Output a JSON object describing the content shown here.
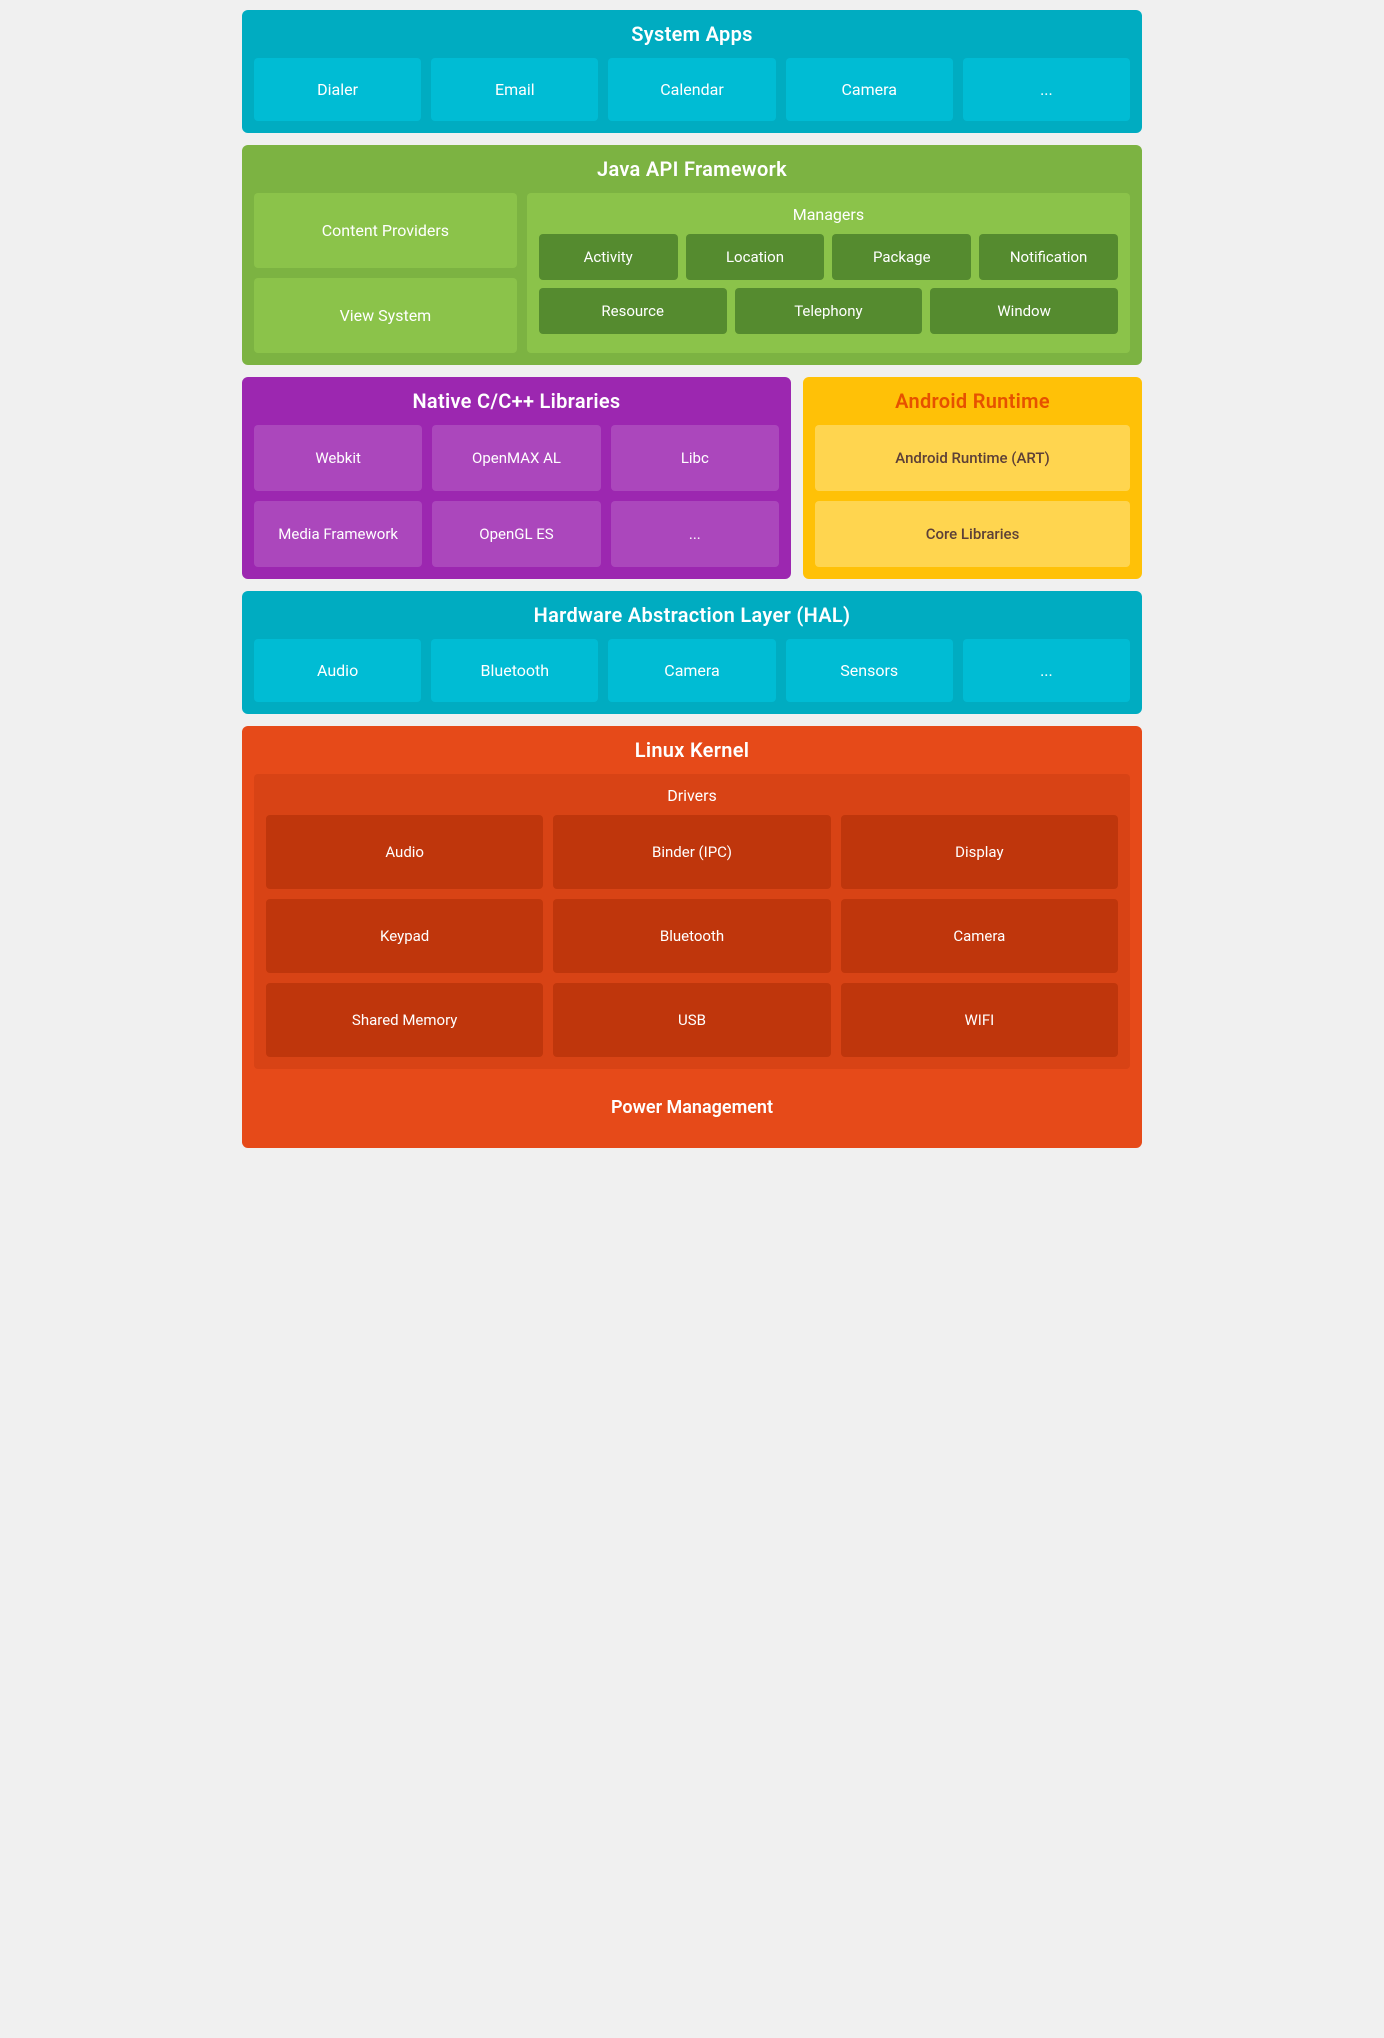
{
  "systemApps": {
    "title": "System Apps",
    "items": [
      "Dialer",
      "Email",
      "Calendar",
      "Camera",
      "..."
    ]
  },
  "javaApi": {
    "title": "Java API Framework",
    "contentProviders": "Content Providers",
    "viewSystem": "View System",
    "managers": {
      "title": "Managers",
      "row1": [
        "Activity",
        "Location",
        "Package",
        "Notification"
      ],
      "row2": [
        "Resource",
        "Telephony",
        "Window"
      ]
    }
  },
  "native": {
    "title": "Native C/C++ Libraries",
    "items": [
      "Webkit",
      "OpenMAX AL",
      "Libc",
      "Media Framework",
      "OpenGL ES",
      "..."
    ]
  },
  "androidRuntime": {
    "title": "Android Runtime",
    "items": [
      "Android Runtime (ART)",
      "Core Libraries"
    ]
  },
  "hal": {
    "title": "Hardware Abstraction Layer (HAL)",
    "items": [
      "Audio",
      "Bluetooth",
      "Camera",
      "Sensors",
      "..."
    ]
  },
  "linuxKernel": {
    "title": "Linux Kernel",
    "drivers": {
      "title": "Drivers",
      "items": [
        "Audio",
        "Binder (IPC)",
        "Display",
        "Keypad",
        "Bluetooth",
        "Camera",
        "Shared Memory",
        "USB",
        "WIFI"
      ]
    },
    "powerManagement": "Power Management"
  }
}
